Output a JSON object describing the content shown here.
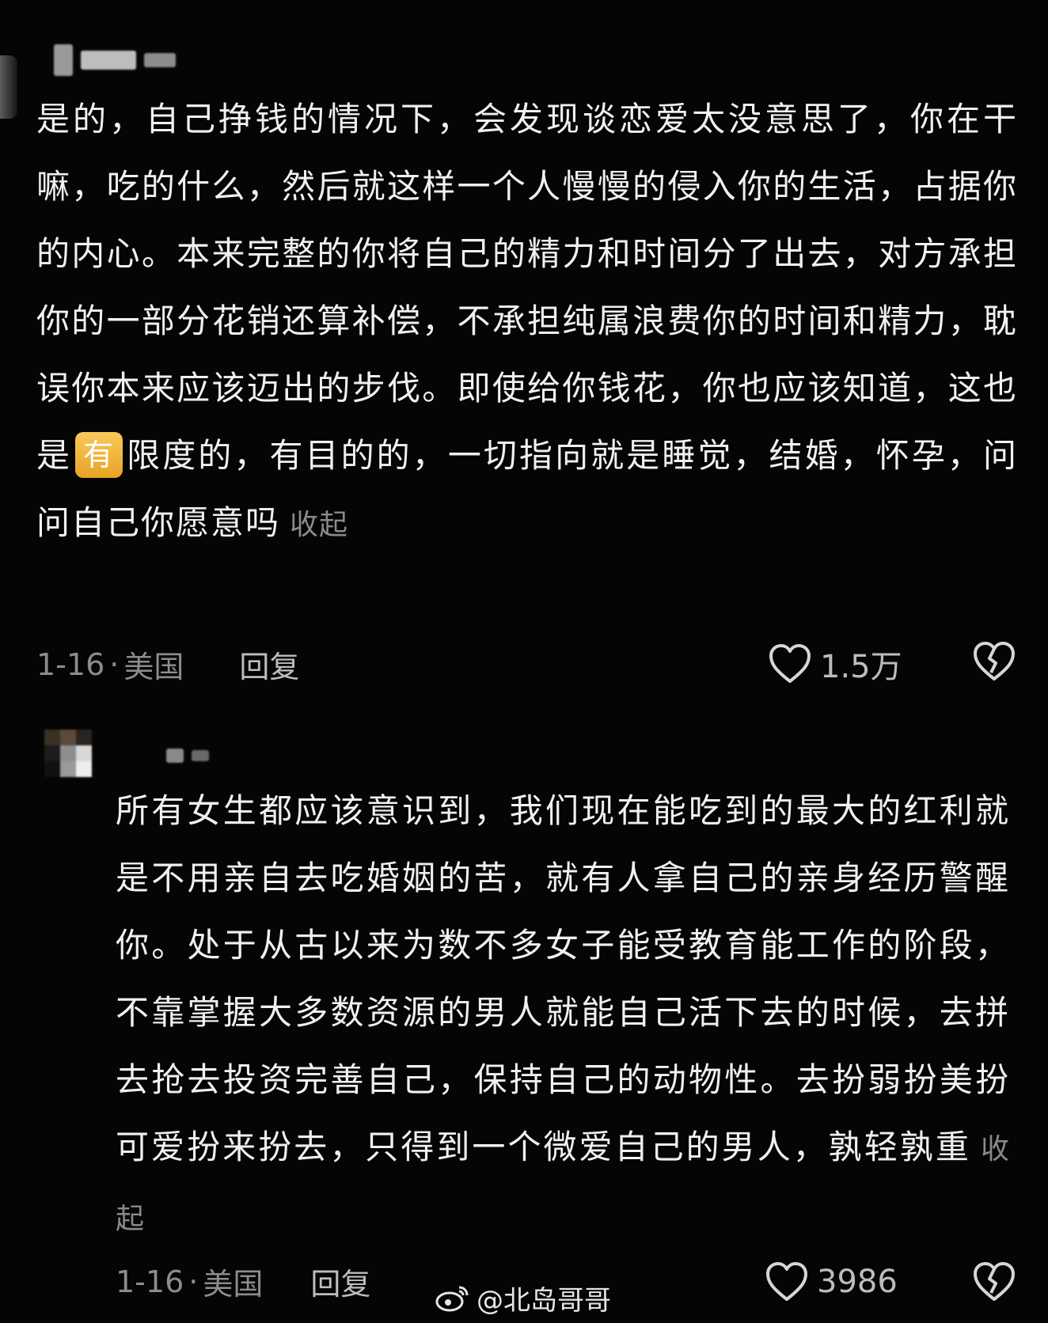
{
  "comments": [
    {
      "text": "是的，自己挣钱的情况下，会发现谈恋爱太没意思了，你在干嘛，吃的什么，然后就这样一个人慢慢的侵入你的生活，占据你的内心。本来完整的你将自己的精力和时间分了出去，对方承担你的一部分花销还算补偿，不承担纯属浪费你的时间和精力，耽误你本来应该迈出的步伐。即使给你钱花，你也应该知道，这也是",
      "emoji": "有",
      "text_after": "限度的，有目的的，一切指向就是睡觉，结婚，怀孕，问问自己你愿意吗",
      "collapse_label": "收起",
      "date": "1-16",
      "separator": "·",
      "location": "美国",
      "reply_label": "回复",
      "likes": "1.5万"
    },
    {
      "text": "所有女生都应该意识到，我们现在能吃到的最大的红利就是不用亲自去吃婚姻的苦，就有人拿自己的亲身经历警醒你。处于从古以来为数不多女子能受教育能工作的阶段，不靠掌握大多数资源的男人就能自己活下去的时候，去拼去抢去投资完善自己，保持自己的动物性。去扮弱扮美扮可爱扮来扮去，只得到一个微爱自己的男人，孰轻孰重",
      "collapse_label": "收起",
      "date": "1-16",
      "separator": "·",
      "location": "美国",
      "reply_label": "回复",
      "likes": "3986"
    }
  ],
  "watermark": {
    "icon": "weibo-icon",
    "text": "@北岛哥哥"
  },
  "colors": {
    "background": "#050505",
    "text": "#f0f0f0",
    "muted": "#8c8c8c",
    "emoji": "#f2b540"
  }
}
